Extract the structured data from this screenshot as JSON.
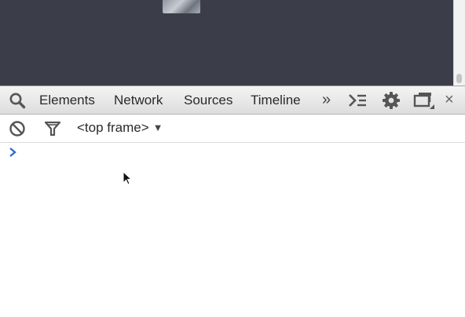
{
  "devtools": {
    "tabs": [
      {
        "label": "Elements"
      },
      {
        "label": "Network"
      },
      {
        "label": "Sources"
      },
      {
        "label": "Timeline"
      }
    ],
    "overflow_label": "»",
    "close_label": "×",
    "icons": {
      "search": "search-icon",
      "drawer": "console-drawer-icon",
      "settings": "gear-icon",
      "dock": "dock-side-icon",
      "clear": "clear-console-icon",
      "filter": "filter-icon",
      "prompt": "prompt-chevron-icon"
    }
  },
  "console": {
    "frame_selector": "<top frame>",
    "frame_arrow": "▼",
    "input_value": ""
  },
  "colors": {
    "page_background": "#3b3e48",
    "toolbar_background": "#e6e6e6",
    "prompt_chevron": "#2f6fd6",
    "text": "#2a2a2a"
  }
}
